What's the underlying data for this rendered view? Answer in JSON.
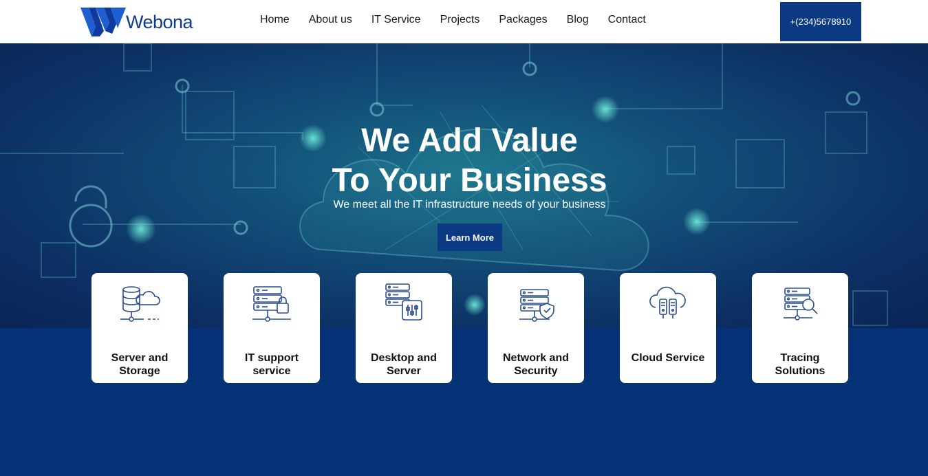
{
  "header": {
    "logo_text": "Webona",
    "nav": [
      "Home",
      "About us",
      "IT Service",
      "Projects",
      "Packages",
      "Blog",
      "Contact"
    ],
    "phone": "+(234)5678910"
  },
  "hero": {
    "title_line1": "We Add Value",
    "title_line2": "To Your Business",
    "subtitle": "We meet all the IT infrastructure needs of your business",
    "cta": "Learn More"
  },
  "services": [
    {
      "line1": "Server and",
      "line2": "Storage",
      "icon": "server-cloud-icon"
    },
    {
      "line1": "IT support",
      "line2": "service",
      "icon": "server-lock-icon"
    },
    {
      "line1": "Desktop and",
      "line2": "Server",
      "icon": "server-settings-icon"
    },
    {
      "line1": "Network and",
      "line2": "Security",
      "icon": "server-shield-icon"
    },
    {
      "line1": "Cloud Service",
      "line2": "",
      "icon": "cloud-servers-icon"
    },
    {
      "line1": "Tracing",
      "line2": "Solutions",
      "icon": "server-search-icon"
    }
  ],
  "colors": {
    "brand": "#0b3a82",
    "band": "#063377",
    "icon_stroke": "#2a4d8c"
  }
}
